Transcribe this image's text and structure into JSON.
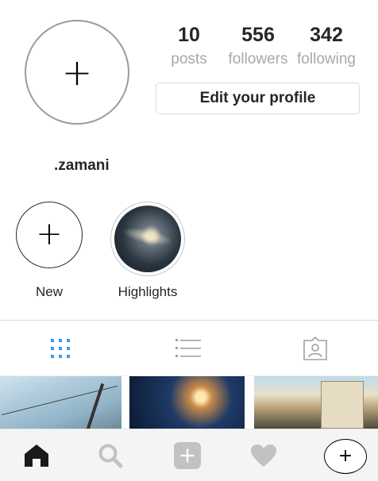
{
  "profile": {
    "avatar_glyph": "+",
    "username": ".zamani"
  },
  "stats": [
    {
      "value": "10",
      "label": "posts"
    },
    {
      "value": "556",
      "label": "followers"
    },
    {
      "value": "342",
      "label": "following"
    }
  ],
  "edit_button_label": "Edit your profile",
  "highlights": {
    "new": {
      "icon": "plus-icon",
      "label": "New"
    },
    "highlights": {
      "icon": "highlight-photo",
      "label": "Highlights"
    }
  },
  "tabs": [
    {
      "icon": "grid-icon",
      "active": true,
      "color": "#3897f0"
    },
    {
      "icon": "list-icon",
      "active": false,
      "color": "#a0a0a0"
    },
    {
      "icon": "tagged-person-icon",
      "active": false,
      "color": "#a0a0a0"
    }
  ],
  "bottom_nav": {
    "home": "home-icon",
    "search": "search-icon",
    "add": "add-icon",
    "heart": "heart-icon",
    "extra_glyph": "+"
  },
  "colors": {
    "text": "#262626",
    "muted": "#a8a8a8",
    "accent": "#3897f0",
    "border": "#dbdbdb",
    "nav_bg": "#f4f4f4",
    "icon_gray": "#c2c2c2"
  }
}
